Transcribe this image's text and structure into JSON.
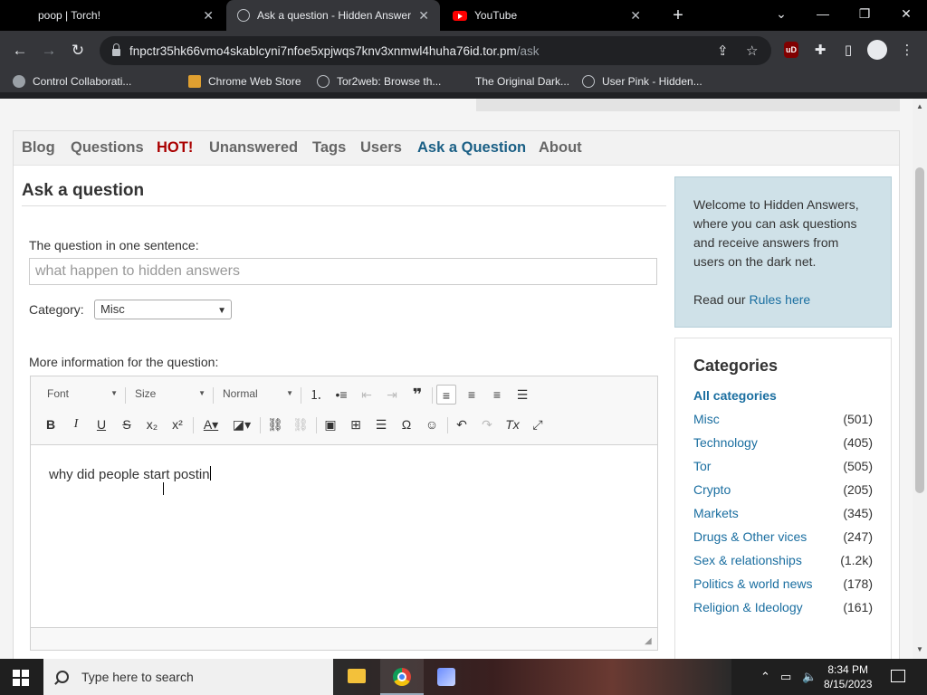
{
  "browser": {
    "tabs": [
      {
        "title": "poop | Torch!",
        "active": false
      },
      {
        "title": "Ask a question - Hidden Answers",
        "active": true
      },
      {
        "title": "YouTube",
        "active": false
      }
    ],
    "url_host": "fnpctr35hk66vmo4skablcyni7nfoe5xpjwqs7knv3xnmwl4huha76id.tor.pm",
    "url_path": "/ask",
    "bookmarks": [
      {
        "label": "Control Collaborati..."
      },
      {
        "label": "Chrome Web Store"
      },
      {
        "label": "Tor2web: Browse th..."
      },
      {
        "label": "The Original Dark..."
      },
      {
        "label": "User Pink - Hidden..."
      }
    ],
    "ublock_label": "uD"
  },
  "site": {
    "nav": [
      "Blog",
      "Questions",
      "HOT!",
      "Unanswered",
      "Tags",
      "Users",
      "Ask a Question",
      "About"
    ],
    "page_title": "Ask a question",
    "question_label": "The question in one sentence:",
    "question_value": "what happen to hidden answers",
    "category_label": "Category:",
    "category_value": "Misc",
    "more_info_label": "More information for the question:",
    "editor": {
      "font_label": "Font",
      "size_label": "Size",
      "format_label": "Normal",
      "body_text": "why did people start postin"
    },
    "welcome": {
      "text": "Welcome to Hidden Answers, where you can ask questions and receive answers from users on the dark net.",
      "read_prefix": "Read our ",
      "rules_link": "Rules here"
    },
    "categories": {
      "title": "Categories",
      "all_label": "All categories",
      "items": [
        {
          "name": "Misc",
          "count": "(501)"
        },
        {
          "name": "Technology",
          "count": "(405)"
        },
        {
          "name": "Tor",
          "count": "(505)"
        },
        {
          "name": "Crypto",
          "count": "(205)"
        },
        {
          "name": "Markets",
          "count": "(345)"
        },
        {
          "name": "Drugs & Other vices",
          "count": "(247)"
        },
        {
          "name": "Sex & relationships",
          "count": "(1.2k)"
        },
        {
          "name": "Politics & world news",
          "count": "(178)"
        },
        {
          "name": "Religion & Ideology",
          "count": "(161)"
        }
      ]
    }
  },
  "taskbar": {
    "search_placeholder": "Type here to search",
    "time": "8:34 PM",
    "date": "8/15/2023"
  },
  "colors": {
    "link": "#1a6ea0",
    "hot": "#aa0000",
    "welcome_bg": "#cfe1e8"
  }
}
